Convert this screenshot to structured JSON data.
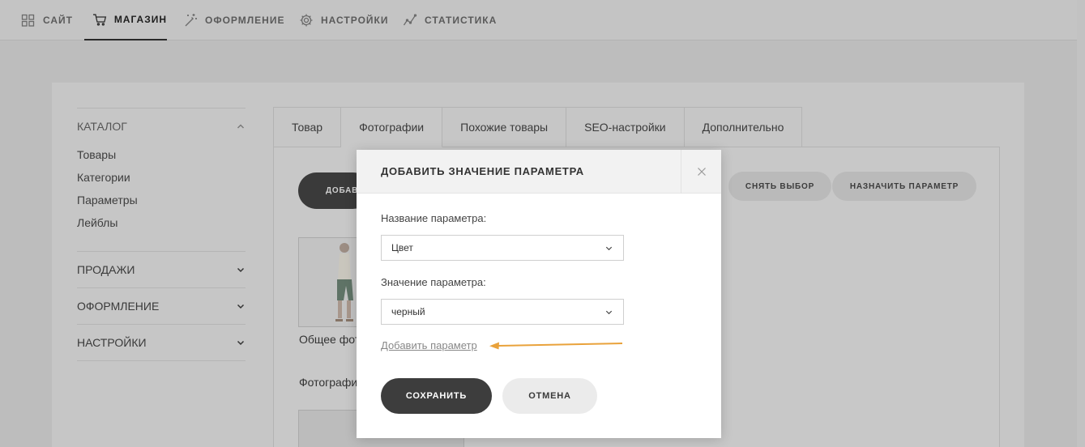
{
  "topnav": {
    "items": [
      {
        "label": "САЙТ",
        "icon": "grid-icon"
      },
      {
        "label": "МАГАЗИН",
        "icon": "cart-icon",
        "active": true
      },
      {
        "label": "ОФОРМЛЕНИЕ",
        "icon": "magic-wand-icon"
      },
      {
        "label": "НАСТРОЙКИ",
        "icon": "gear-icon"
      },
      {
        "label": "СТАТИСТИКА",
        "icon": "chart-line-icon"
      }
    ]
  },
  "sidebar": {
    "catalog": {
      "title": "КАТАЛОГ",
      "items": [
        "Товары",
        "Категории",
        "Параметры",
        "Лейблы"
      ]
    },
    "sections": [
      "ПРОДАЖИ",
      "ОФОРМЛЕНИЕ",
      "НАСТРОЙКИ"
    ]
  },
  "tabs": [
    {
      "label": "Товар"
    },
    {
      "label": "Фотографии",
      "active": true
    },
    {
      "label": "Похожие товары"
    },
    {
      "label": "SEO-настройки"
    },
    {
      "label": "Дополнительно"
    }
  ],
  "toolbar": {
    "add_label": "ДОБАВ",
    "deselect_label": "СНЯТЬ ВЫБОР",
    "assign_label": "НАЗНАЧИТЬ ПАРАМЕТР"
  },
  "content": {
    "general_photo_caption": "Общее фото",
    "photos_caption": "Фотографии"
  },
  "modal": {
    "title": "ДОБАВИТЬ ЗНАЧЕНИЕ ПАРАМЕТРА",
    "param_name_label": "Название параметра:",
    "param_name_value": "Цвет",
    "param_value_label": "Значение параметра:",
    "param_value_value": "черный",
    "add_param_link": "Добавить параметр",
    "save_label": "СОХРАНИТЬ",
    "cancel_label": "ОТМЕНА"
  },
  "colors": {
    "overlay": "#bdbdbd",
    "modal_bg": "#ffffff",
    "primary_button": "#3d3d3d",
    "arrow": "#e9a23b"
  }
}
